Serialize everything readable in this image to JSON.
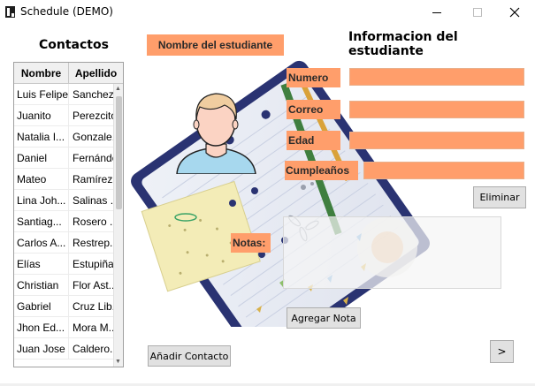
{
  "window": {
    "title": "Schedule (DEMO)",
    "minimize_glyph": "—",
    "maximize_glyph": "☐",
    "close_glyph": "✕"
  },
  "contacts": {
    "title": "Contactos",
    "columns": [
      "Nombre",
      "Apellido"
    ],
    "rows": [
      {
        "nombre": "Luis Felipe",
        "apellido": "Sanchez..."
      },
      {
        "nombre": "Juanito",
        "apellido": "Perezcito"
      },
      {
        "nombre": "Natalia I...",
        "apellido": "Gonzale..."
      },
      {
        "nombre": "Daniel",
        "apellido": "Fernández"
      },
      {
        "nombre": "Mateo",
        "apellido": "Ramírez..."
      },
      {
        "nombre": "Lina Joh...",
        "apellido": "Salinas ..."
      },
      {
        "nombre": "Santiag...",
        "apellido": "Rosero ..."
      },
      {
        "nombre": "Carlos A...",
        "apellido": "Restrep..."
      },
      {
        "nombre": "Elías",
        "apellido": "Estupiña"
      },
      {
        "nombre": "Christian",
        "apellido": "Flor Ast..."
      },
      {
        "nombre": "Gabriel",
        "apellido": "Cruz Lib..."
      },
      {
        "nombre": "Jhon Ed...",
        "apellido": "Mora M..."
      },
      {
        "nombre": "Juan Jose",
        "apellido": "Caldero..."
      }
    ]
  },
  "student": {
    "name_label": "Nombre del estudiante",
    "info_title": "Informacion del estudiante",
    "fields": {
      "numero": {
        "label": "Numero",
        "value": ""
      },
      "correo": {
        "label": "Correo",
        "value": ""
      },
      "edad": {
        "label": "Edad",
        "value": ""
      },
      "cumpleanos": {
        "label": "Cumpleaños",
        "value": ""
      }
    },
    "notes_label": "Notas:"
  },
  "buttons": {
    "eliminar": "Eliminar",
    "agregar_nota": "Agregar Nota",
    "anadir_contacto": "Añadir Contacto",
    "next": ">"
  },
  "colors": {
    "accent_orange": "#ff9e6b",
    "button_gray": "#e1e1e1"
  },
  "icons": [
    "app-icon",
    "avatar-icon",
    "minimize-icon",
    "maximize-icon",
    "close-icon"
  ]
}
